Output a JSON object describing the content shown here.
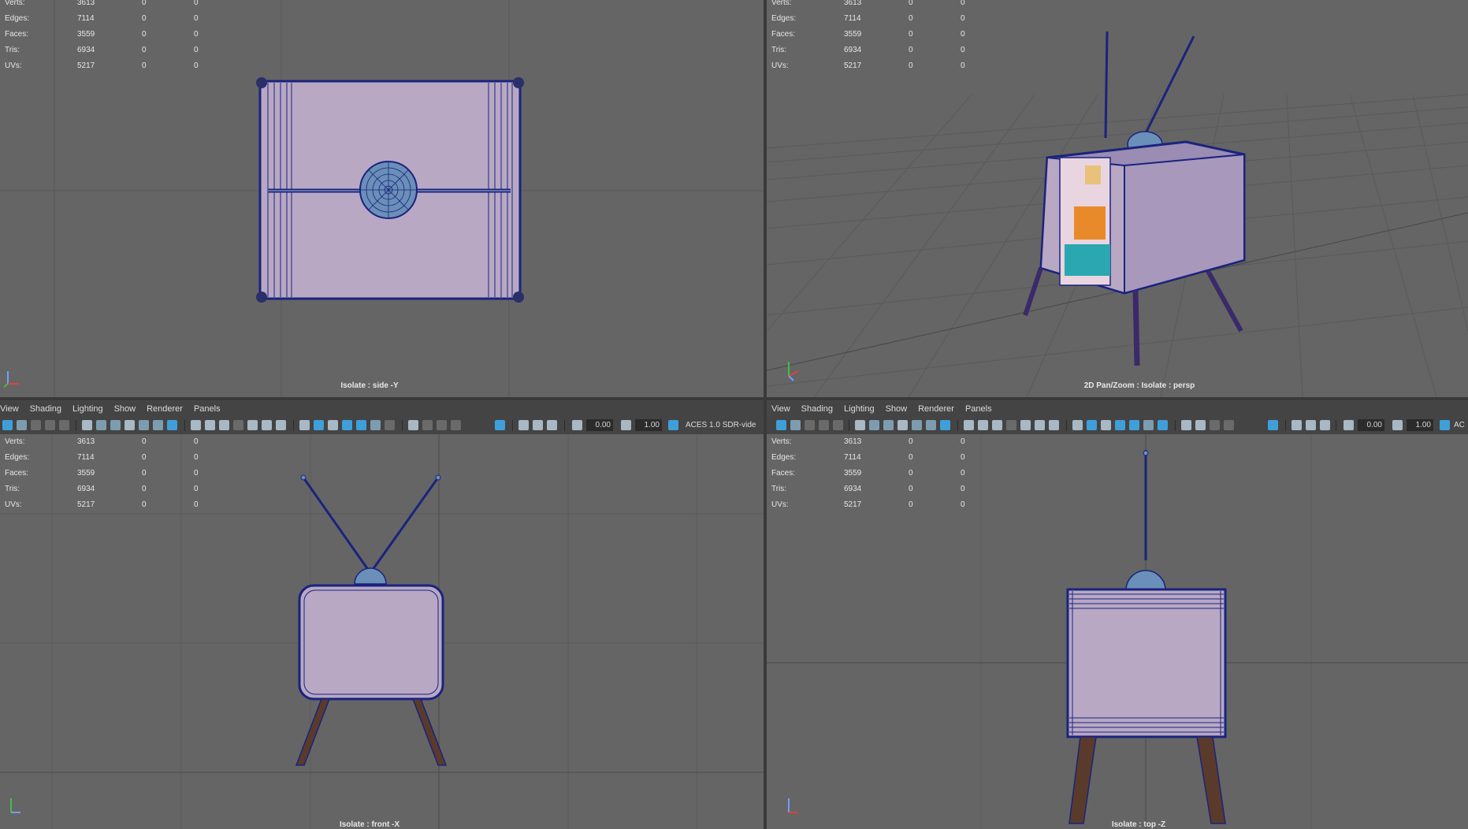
{
  "colors": {
    "viewport_bg": "#656565",
    "grid_line": "#5a5a5a",
    "axis_line": "#4a4a4a",
    "wire": "#1a237e",
    "body_fill": "#b8a8c4",
    "leg_fill": "#5a3a2a",
    "accent": "#3f9fd9"
  },
  "stats_labels": [
    "Verts:",
    "Edges:",
    "Faces:",
    "Tris:",
    "UVs:"
  ],
  "stats_values": [
    [
      "3613",
      "0",
      "0"
    ],
    [
      "7114",
      "0",
      "0"
    ],
    [
      "3559",
      "0",
      "0"
    ],
    [
      "6934",
      "0",
      "0"
    ],
    [
      "5217",
      "0",
      "0"
    ]
  ],
  "menu": [
    "View",
    "Shading",
    "Lighting",
    "Show",
    "Renderer",
    "Panels"
  ],
  "toolbar": {
    "field1": "0.00",
    "field2": "1.00",
    "color_space_left": "ACES 1.0 SDR-vide",
    "color_space_right": "AC"
  },
  "viewports": {
    "side": {
      "caption": "Isolate : side -Y"
    },
    "persp": {
      "caption": "2D Pan/Zoom : Isolate : persp"
    },
    "front": {
      "caption": "Isolate : front -X"
    },
    "top": {
      "caption": "Isolate : top -Z"
    }
  },
  "axis_labels": {
    "x": "x",
    "y": "y",
    "z": "z"
  }
}
